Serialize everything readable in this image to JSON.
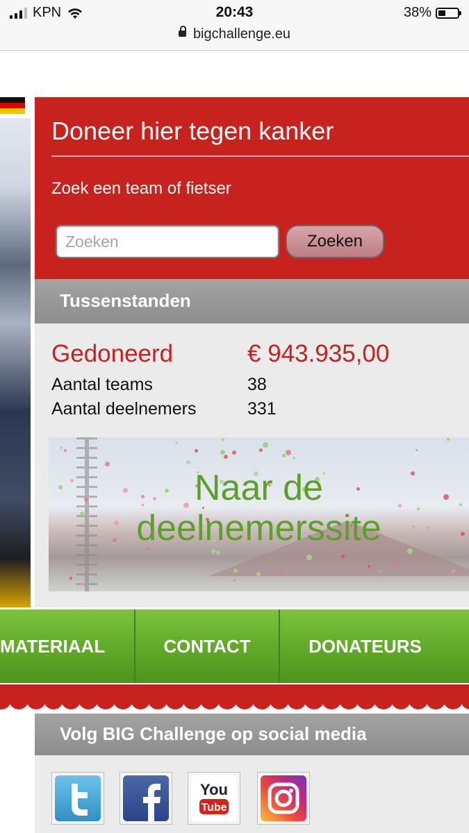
{
  "status_bar": {
    "carrier": "KPN",
    "time": "20:43",
    "battery": "38%",
    "battery_level": 0.38,
    "url": "bigchallenge.eu"
  },
  "donate": {
    "title": "Doneer hier tegen kanker",
    "subtitle": "Zoek een team of fietser",
    "search_placeholder": "Zoeken",
    "search_button": "Zoeken"
  },
  "standings": {
    "header": "Tussenstanden",
    "donated_label": "Gedoneerd",
    "donated_value": "€ 943.935,00",
    "teams_label": "Aantal teams",
    "teams_value": "38",
    "participants_label": "Aantal deelnemers",
    "participants_value": "331"
  },
  "banner": {
    "line1": "Naar de",
    "line2": "deelnemerssite"
  },
  "nav": {
    "items": [
      "MATERIAAL",
      "CONTACT",
      "DONATEURS"
    ]
  },
  "social": {
    "header": "Volg BIG Challenge op social media",
    "icons": [
      "twitter-icon",
      "facebook-icon",
      "youtube-icon",
      "instagram-icon"
    ]
  },
  "colors": {
    "brand_red": "#c8221f",
    "nav_green": "#5fa828",
    "banner_text_green": "#5ca02b"
  }
}
